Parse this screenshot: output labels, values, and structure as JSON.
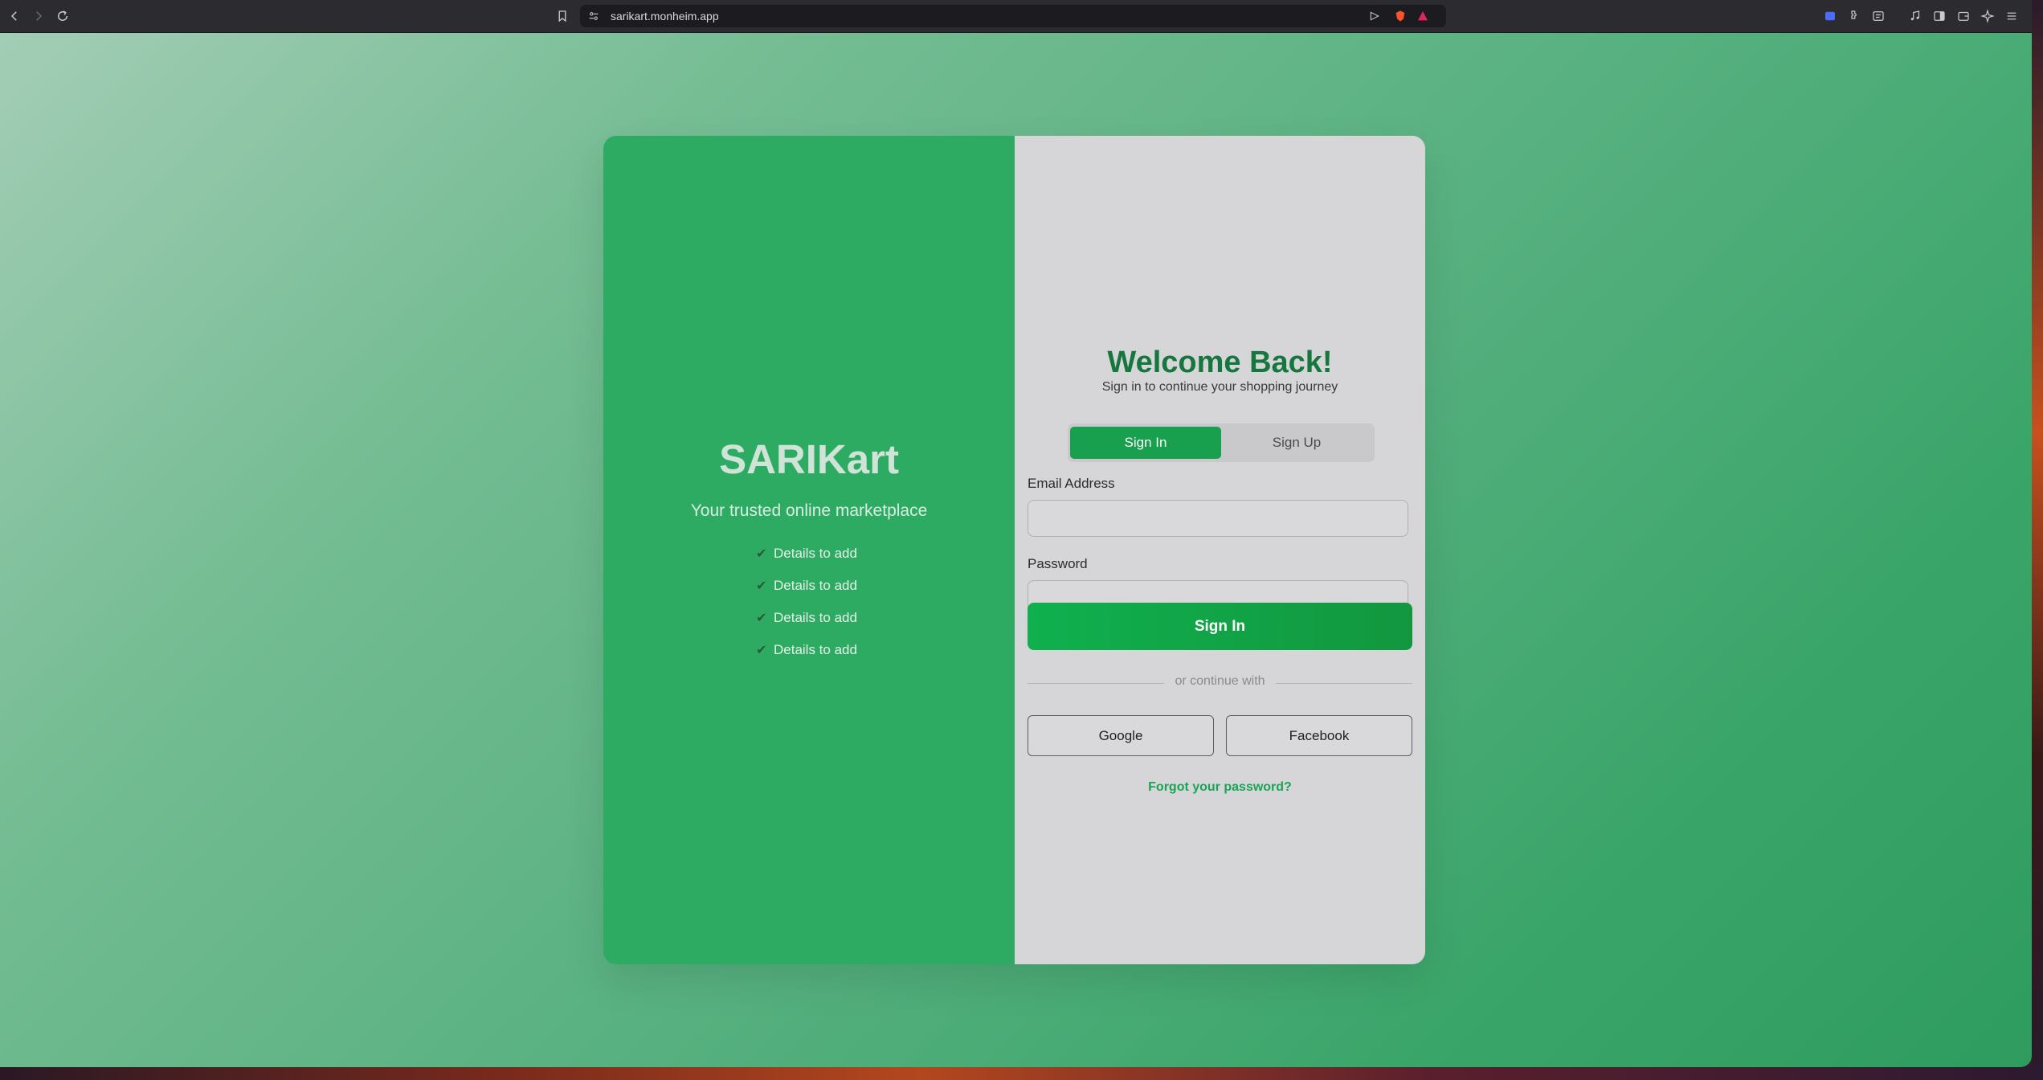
{
  "browser": {
    "url": "sarikart.monheim.app"
  },
  "brand": {
    "title": "SARIKart",
    "tagline": "Your trusted online marketplace",
    "features": [
      {
        "check": "✔",
        "label": "Details to add"
      },
      {
        "check": "✔",
        "label": "Details to add"
      },
      {
        "check": "✔",
        "label": "Details to add"
      },
      {
        "check": "✔",
        "label": "Details to add"
      }
    ]
  },
  "auth": {
    "heading": "Welcome Back!",
    "subheading": "Sign in to continue your shopping journey",
    "tabs": [
      {
        "label": "Sign In",
        "active": true
      },
      {
        "label": "Sign Up",
        "active": false
      }
    ],
    "email_label": "Email Address",
    "email_value": "",
    "password_label": "Password",
    "password_value": "",
    "submit_label": "Sign In",
    "divider_text": "or continue with",
    "google_label": "Google",
    "facebook_label": "Facebook",
    "forgot_label": "Forgot your password?"
  },
  "colors": {
    "brand_green": "#2eab63",
    "primary_green": "#18a04f",
    "heading_green": "#15773e",
    "panel_gray": "#d6d6d8"
  }
}
